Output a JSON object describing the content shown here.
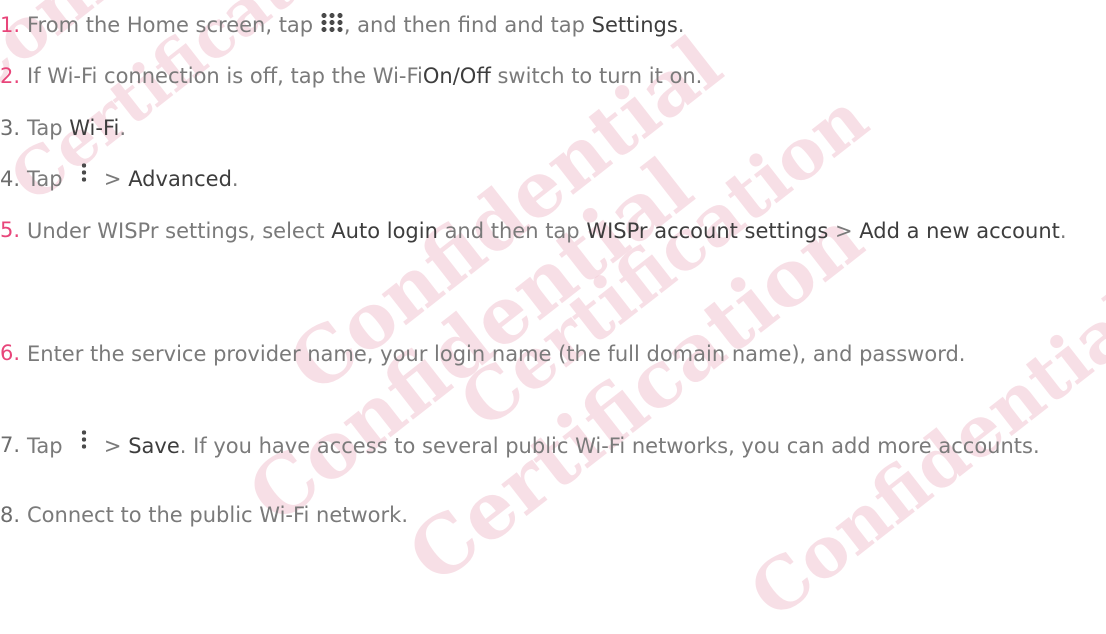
{
  "watermark": {
    "primary": "Confidential",
    "secondary": "Certification"
  },
  "steps": [
    {
      "num": "1.",
      "parts": [
        "From the Home screen, tap ",
        ", and then find and tap ",
        "Settings",
        "."
      ],
      "icon": "all-apps-grid-icon"
    },
    {
      "num": "2.",
      "parts": [
        "If Wi-Fi connection is off, tap the Wi-Fi",
        "On/Off",
        " switch to turn it on."
      ]
    },
    {
      "num": "3.",
      "parts": [
        "Tap ",
        "Wi-Fi",
        "."
      ]
    },
    {
      "num": "4.",
      "parts": [
        "Tap ",
        " > ",
        "Advanced",
        "."
      ],
      "icon": "more-options-icon"
    },
    {
      "num": "5.",
      "parts": [
        "Under WISPr settings, select ",
        "Auto login",
        " and then tap ",
        "WISPr account settings",
        " > ",
        "Add a new account",
        "."
      ]
    },
    {
      "num": "6.",
      "parts": [
        "Enter the service provider name, your login name (the full domain name), and password."
      ]
    },
    {
      "num": "7.",
      "parts": [
        "Tap ",
        " > ",
        "Save",
        ". If you have access to several public Wi-Fi networks, you can add more accounts."
      ],
      "icon": "more-options-icon"
    },
    {
      "num": "8.",
      "parts": [
        "Connect to the public Wi-Fi network."
      ]
    }
  ]
}
